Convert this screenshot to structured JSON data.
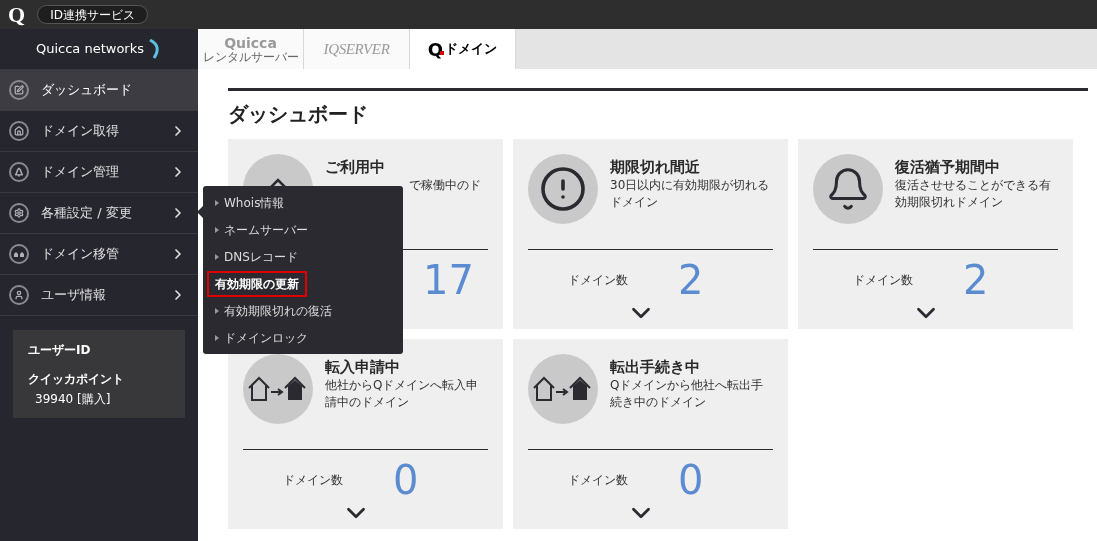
{
  "header": {
    "logo": "Q",
    "service_button": "ID連携サービス"
  },
  "sidebar": {
    "brand": "Quicca networks",
    "items": [
      {
        "label": "ダッシュボード",
        "kind": "edit",
        "selected": true,
        "has_arrow": false
      },
      {
        "label": "ドメイン取得",
        "kind": "home",
        "selected": false,
        "has_arrow": true
      },
      {
        "label": "ドメイン管理",
        "kind": "tree",
        "selected": false,
        "has_arrow": true
      },
      {
        "label": "各種設定 / 変更",
        "kind": "gear",
        "selected": false,
        "has_arrow": true
      },
      {
        "label": "ドメイン移管",
        "kind": "transfer",
        "selected": false,
        "has_arrow": true
      },
      {
        "label": "ユーザ情報",
        "kind": "user",
        "selected": false,
        "has_arrow": true
      }
    ],
    "user_box": {
      "user_id_label": "ユーザーID",
      "points_label": "クイッカポイント",
      "points_value": "39940 [購入]"
    }
  },
  "submenu": {
    "items": [
      {
        "label": "Whois情報",
        "selected": false
      },
      {
        "label": "ネームサーバー",
        "selected": false
      },
      {
        "label": "DNSレコード",
        "selected": false
      },
      {
        "label": "有効期限の更新",
        "selected": true
      },
      {
        "label": "有効期限切れの復活",
        "selected": false
      },
      {
        "label": "ドメインロック",
        "selected": false
      }
    ]
  },
  "tabs": [
    {
      "label": "Quicca",
      "sublabel": "レンタルサーバー",
      "kind": "quicca",
      "selected": false
    },
    {
      "label": "IQSERVER",
      "kind": "iqserver",
      "selected": false
    },
    {
      "label": "ドメイン",
      "kind": "qdomain",
      "mark": "Q",
      "selected": true
    }
  ],
  "page_title": "ダッシュボード",
  "cards": [
    {
      "title": "ご利用中",
      "description": "で稼働中のド",
      "kind": "house",
      "covered": true,
      "count": "17"
    },
    {
      "title": "期限切れ間近",
      "description": "30日以内に有効期限が切れるドメイン",
      "kind": "alert",
      "covered": false,
      "count_label": "ドメイン数",
      "count": "2"
    },
    {
      "title": "復活猶予期間中",
      "description": "復活させせることができる有効期限切れドメイン",
      "kind": "bell",
      "covered": false,
      "count_label": "ドメイン数",
      "count": "2"
    },
    {
      "title": "転入申請中",
      "description": "他社からQドメインへ転入申請中のドメイン",
      "kind": "transfer",
      "covered": false,
      "count_label": "ドメイン数",
      "count": "0"
    },
    {
      "title": "転出手続き中",
      "description": "Qドメインから他社へ転出手続き中のドメイン",
      "kind": "transfer",
      "covered": false,
      "count_label": "ドメイン数",
      "count": "0"
    }
  ]
}
